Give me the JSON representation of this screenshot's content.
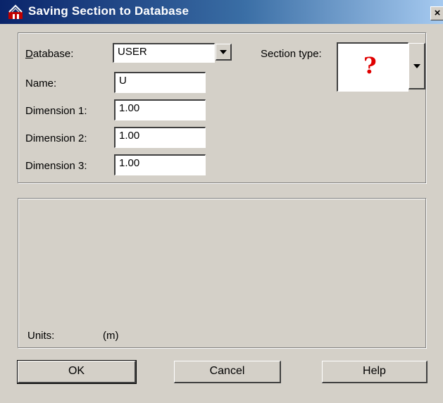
{
  "window": {
    "title": "Saving Section to Database",
    "icon": "app-icon",
    "close_label": "×"
  },
  "form": {
    "database_label_accel": "D",
    "database_label_rest": "atabase:",
    "database_value": "USER",
    "name_label": "Name:",
    "name_value": "U",
    "dim1_label": "Dimension 1:",
    "dim1_value": "1.00",
    "dim2_label": "Dimension 2:",
    "dim2_value": "1.00",
    "dim3_label": "Dimension 3:",
    "dim3_value": "1.00",
    "section_type_label": "Section type:",
    "section_type_glyph": "?"
  },
  "units": {
    "label": "Units:",
    "value": "(m)"
  },
  "buttons": {
    "ok": "OK",
    "cancel": "Cancel",
    "help": "Help"
  },
  "colors": {
    "dialog_bg": "#d4d0c8",
    "title_start": "#0a246a",
    "title_end": "#a6caf0",
    "question_mark": "#e00000"
  }
}
